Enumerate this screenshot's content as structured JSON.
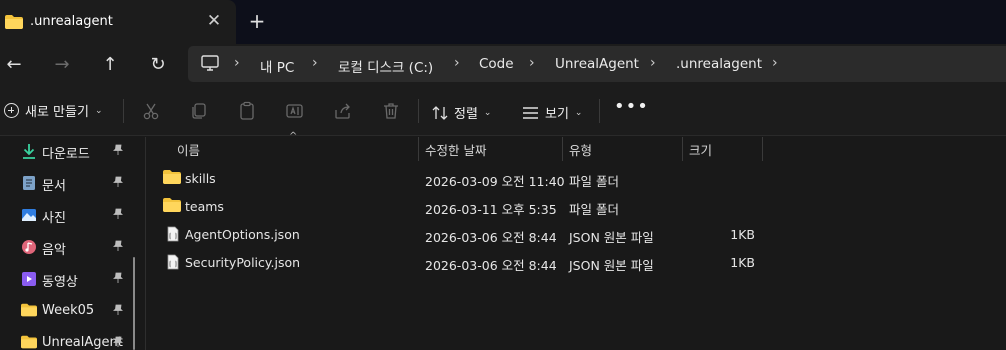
{
  "tab": {
    "title": ".unrealagent",
    "close": "✕",
    "new": "+"
  },
  "nav": {
    "back": "←",
    "forward": "→",
    "up": "↑",
    "refresh": "↻"
  },
  "breadcrumb": [
    {
      "label": "내 PC"
    },
    {
      "label": "로컬 디스크 (C:)"
    },
    {
      "label": "Code"
    },
    {
      "label": "UnrealAgent"
    },
    {
      "label": ".unrealagent"
    }
  ],
  "toolbar": {
    "new_label": "새로 만들기",
    "sort_label": "정렬",
    "view_label": "보기",
    "more_label": "•••",
    "chevron": "⌄"
  },
  "sidebar": {
    "items": [
      {
        "label": "다운로드",
        "icon": "download-icon"
      },
      {
        "label": "문서",
        "icon": "document-icon"
      },
      {
        "label": "사진",
        "icon": "pictures-icon"
      },
      {
        "label": "음악",
        "icon": "music-icon"
      },
      {
        "label": "동영상",
        "icon": "video-icon"
      },
      {
        "label": "Week05",
        "icon": "folder-icon"
      },
      {
        "label": "UnrealAgent",
        "icon": "folder-icon"
      }
    ]
  },
  "columns": {
    "name": "이름",
    "modified": "수정한 날짜",
    "type": "유형",
    "size": "크기"
  },
  "files": [
    {
      "name": "skills",
      "modified": "2026-03-09 오전 11:40",
      "type": "파일 폴더",
      "size": "",
      "icon": "folder-icon"
    },
    {
      "name": "teams",
      "modified": "2026-03-11 오후 5:35",
      "type": "파일 폴더",
      "size": "",
      "icon": "folder-icon"
    },
    {
      "name": "AgentOptions.json",
      "modified": "2026-03-06 오전 8:44",
      "type": "JSON 원본 파일",
      "size": "1KB",
      "icon": "json-file-icon"
    },
    {
      "name": "SecurityPolicy.json",
      "modified": "2026-03-06 오전 8:44",
      "type": "JSON 원본 파일",
      "size": "1KB",
      "icon": "json-file-icon"
    }
  ],
  "colors": {
    "folder": "#f3c33c",
    "accent": "#4cc2ff",
    "background": "#191919"
  }
}
